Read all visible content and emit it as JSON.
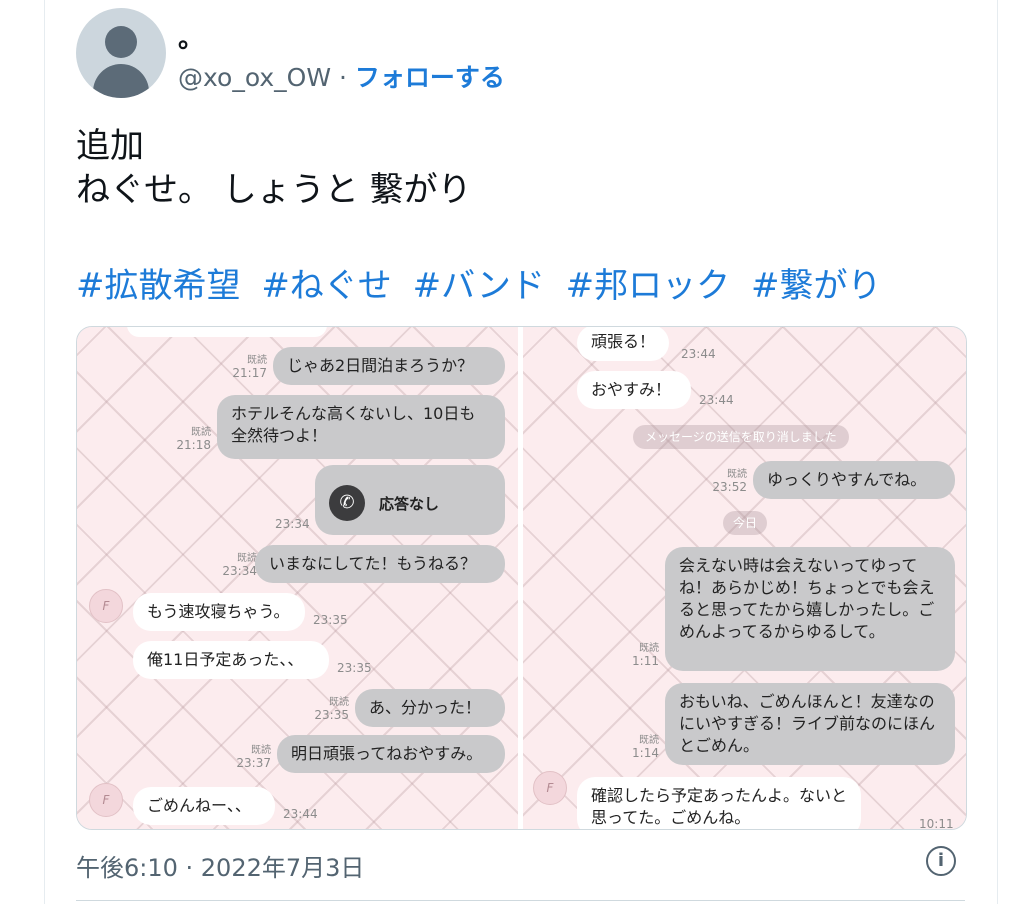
{
  "tweet": {
    "display_name": "。",
    "handle": "@xo_ox_OW",
    "separator": "·",
    "follow_label": "フォローする",
    "text_line1": "追加",
    "text_line2": "ねぐせ。 しょうと 繋がり",
    "hashtags": [
      "#拡散希望",
      "#ねぐせ",
      "#バンド",
      "#邦ロック",
      "#繋がり"
    ],
    "timestamp": "午後6:10 · 2022年7月3日",
    "info_icon": "info-icon"
  },
  "chat_left": {
    "read_label": "既読",
    "msg1": {
      "text": "じゃあ2日間泊まろうか？",
      "time": "21:17"
    },
    "msg2": {
      "text": "ホテルそんな高くないし、10日も全然待つよ！",
      "time": "21:18"
    },
    "call": {
      "label": "応答なし",
      "time": "23:34",
      "icon": "phone-icon"
    },
    "msg3": {
      "text": "いまなにしてた！もうねる？",
      "time": "23:34"
    },
    "msg4": {
      "text": "もう速攻寝ちゃう。",
      "time": "23:35"
    },
    "msg5": {
      "text": "俺11日予定あった、、",
      "time": "23:35"
    },
    "msg6": {
      "text": "あ、分かった！",
      "time": "23:35"
    },
    "msg7": {
      "text": "明日頑張ってねおやすみ。",
      "time": "23:37"
    },
    "msg8": {
      "text": "ごめんねー、、",
      "time": "23:44"
    }
  },
  "chat_right": {
    "read_label": "既読",
    "msg1": {
      "text": "頑張る！",
      "time": "23:44"
    },
    "msg2": {
      "text": "おやすみ！",
      "time": "23:44"
    },
    "unsent": "メッセージの送信を取り消しました",
    "msg3": {
      "text": "ゆっくりやすんでね。",
      "time": "23:52"
    },
    "date_divider": "今日",
    "msg4": {
      "text": "会えない時は会えないってゆってね！あらかじめ！ちょっとでも会えると思ってたから嬉しかったし。ごめんよってるからゆるして。",
      "time": "1:11"
    },
    "msg5": {
      "text": "おもいね、ごめんほんと！友達なのにいやすぎる！ライブ前なのにほんとごめん。",
      "time": "1:14"
    },
    "msg6": {
      "text": "確認したら予定あったんよ。ないと思ってた。ごめんね。",
      "time": "10:11"
    }
  }
}
